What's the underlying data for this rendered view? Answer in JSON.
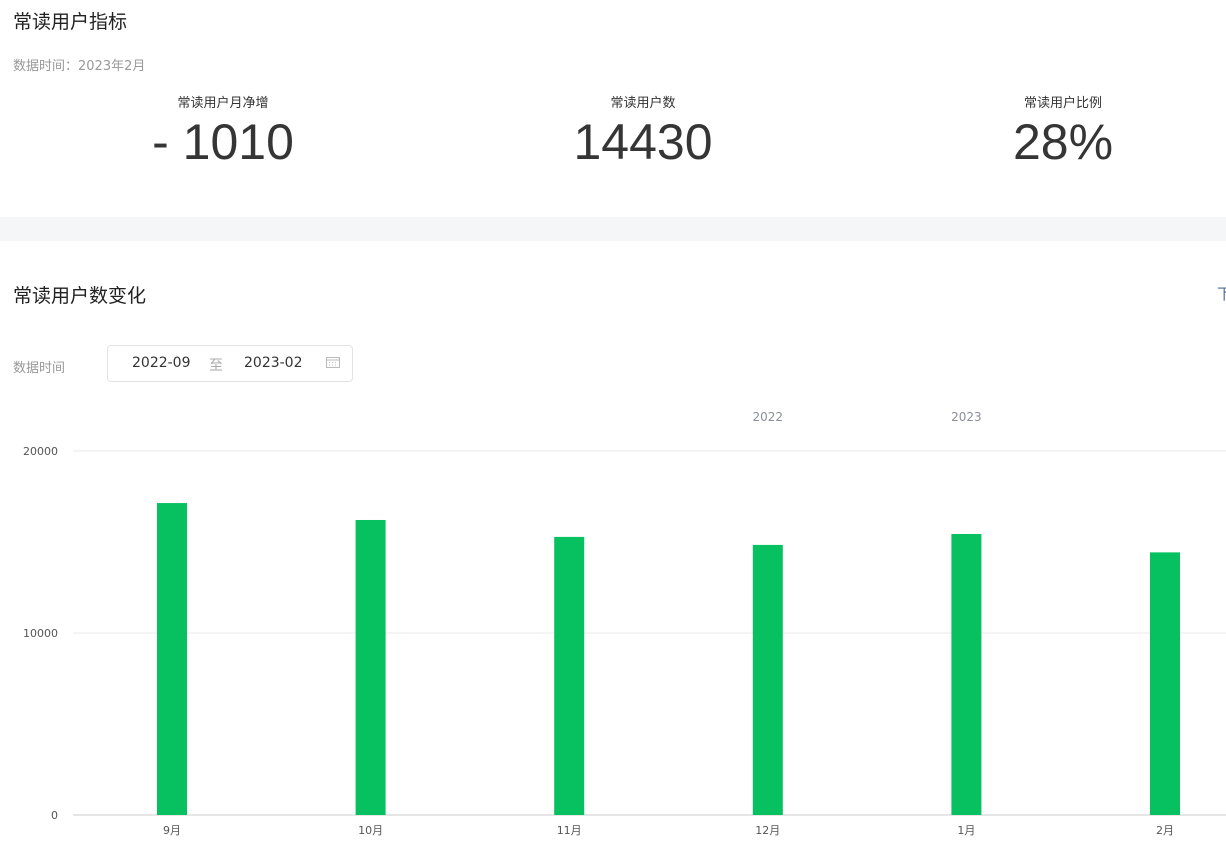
{
  "section1": {
    "title": "常读用户指标",
    "data_time": "数据时间：2023年2月",
    "metrics": [
      {
        "label": "常读用户月净增",
        "value": "- 1010"
      },
      {
        "label": "常读用户数",
        "value": "14430"
      },
      {
        "label": "常读用户比例",
        "value": "28%"
      }
    ]
  },
  "section2": {
    "title": "常读用户数变化",
    "action_partial": "下",
    "filter_label": "数据时间",
    "start": "2022-09",
    "separator": "至",
    "end": "2023-02"
  },
  "colors": {
    "bar": "#07c160"
  },
  "chart_data": {
    "type": "bar",
    "categories": [
      "9月",
      "10月",
      "11月",
      "12月",
      "1月",
      "2月"
    ],
    "values": [
      17140,
      16210,
      15280,
      14840,
      15440,
      14430
    ],
    "year_markers": [
      {
        "category_index": 3,
        "label": "2022"
      },
      {
        "category_index": 4,
        "label": "2023"
      }
    ],
    "yticks": [
      "0",
      "10000",
      "20000"
    ],
    "ylim": [
      0,
      20000
    ],
    "title": "",
    "xlabel": "",
    "ylabel": "",
    "grid": true
  }
}
